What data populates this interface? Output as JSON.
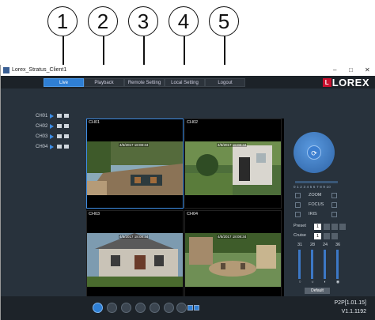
{
  "callouts": [
    "1",
    "2",
    "3",
    "4",
    "5"
  ],
  "window": {
    "title": "Lorex_Stratus_Client1",
    "controls": {
      "minimize": "–",
      "maximize": "□",
      "close": "✕"
    }
  },
  "menu": {
    "tabs": [
      {
        "label": "Live",
        "active": true
      },
      {
        "label": "Playback",
        "active": false
      },
      {
        "label": "Remote Setting",
        "active": false
      },
      {
        "label": "Local Setting",
        "active": false
      },
      {
        "label": "Logout",
        "active": false
      }
    ]
  },
  "brand": {
    "logo_text": "LOREX",
    "logo_mark": "L",
    "color": "#c8102e"
  },
  "channels": [
    {
      "label": "CH01"
    },
    {
      "label": "CH02"
    },
    {
      "label": "CH03"
    },
    {
      "label": "CH04"
    }
  ],
  "views": [
    {
      "name": "CH01",
      "stamp": "4/5/2017 18:08:34"
    },
    {
      "name": "CH02",
      "stamp": "4/5/2017 18:08:34"
    },
    {
      "name": "CH03",
      "stamp": "4/5/2017 18:08:34"
    },
    {
      "name": "CH04",
      "stamp": "4/5/2017 18:08:34"
    }
  ],
  "ptz": {
    "center_icon": "refresh-icon",
    "speed_labels": "0 1 2 3 4 5 6 7 8 9 10",
    "zoom_label": "ZOOM",
    "focus_label": "FOCUS",
    "iris_label": "IRIS"
  },
  "preset": {
    "label": "Preset",
    "value": "1"
  },
  "cruise": {
    "label": "Cruise",
    "value": "1"
  },
  "image_settings": {
    "values": [
      "31",
      "28",
      "24",
      "36"
    ]
  },
  "default_button": "Default",
  "status": {
    "p2p": "P2P[1.01.15]",
    "version": "V1.1.1192"
  },
  "colors": {
    "accent": "#2f7fd4",
    "background": "#212a33"
  }
}
